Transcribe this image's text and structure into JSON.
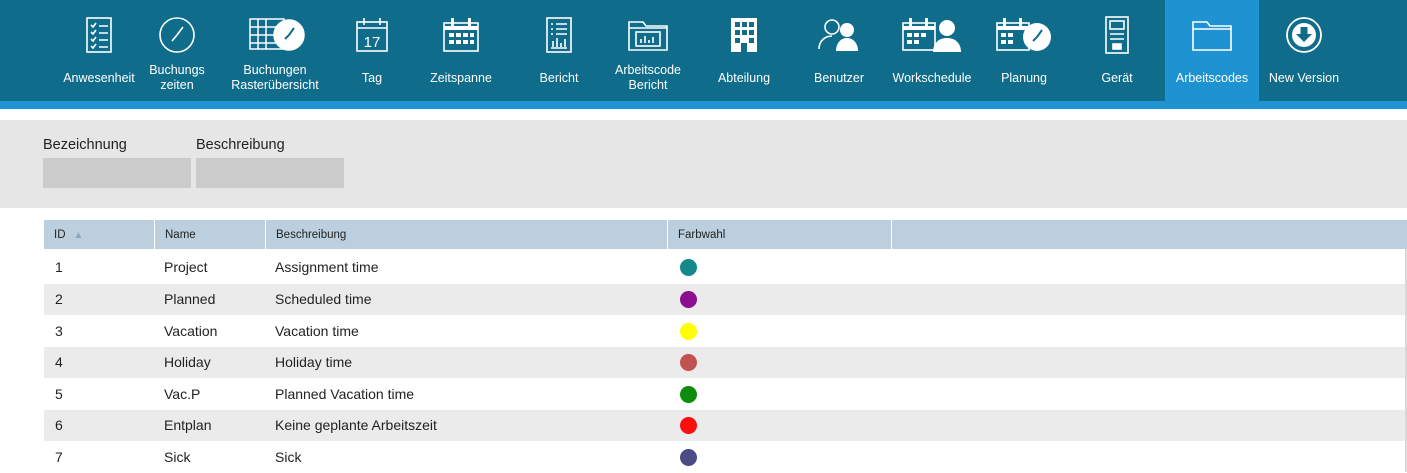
{
  "nav": {
    "items": [
      {
        "label": "Anwesenheit",
        "icon": "attendance-list-icon"
      },
      {
        "label": "Buchungs\nzeiten",
        "icon": "clock-icon"
      },
      {
        "label": "Buchungen\nRasterübersicht",
        "icon": "grid-clock-icon"
      },
      {
        "label": "Tag",
        "icon": "calendar-day-icon",
        "day_number": "17"
      },
      {
        "label": "Zeitspanne",
        "icon": "calendar-range-icon"
      },
      {
        "label": "Bericht",
        "icon": "report-icon"
      },
      {
        "label": "Arbeitscode\nBericht",
        "icon": "folder-chart-icon"
      },
      {
        "label": "Abteilung",
        "icon": "building-icon"
      },
      {
        "label": "Benutzer",
        "icon": "users-icon"
      },
      {
        "label": "Workschedule",
        "icon": "calendar-user-icon"
      },
      {
        "label": "Planung",
        "icon": "calendar-clock-icon"
      },
      {
        "label": "Gerät",
        "icon": "device-icon"
      },
      {
        "label": "Arbeitscodes",
        "icon": "folder-icon",
        "active": true
      },
      {
        "label": "New Version",
        "icon": "download-circle-icon"
      }
    ]
  },
  "filter": {
    "name_label": "Bezeichnung",
    "description_label": "Beschreibung",
    "name_value": "",
    "description_value": ""
  },
  "grid": {
    "columns": [
      "ID",
      "Name",
      "Beschreibung",
      "Farbwahl"
    ],
    "sort_column": "ID",
    "sort_direction": "ascending",
    "rows": [
      {
        "id": "1",
        "name": "Project",
        "description": "Assignment time",
        "color": "#14898c"
      },
      {
        "id": "2",
        "name": "Planned",
        "description": "Scheduled time",
        "color": "#8b0f8e"
      },
      {
        "id": "3",
        "name": "Vacation",
        "description": "Vacation time",
        "color": "#ffff00"
      },
      {
        "id": "4",
        "name": "Holiday",
        "description": "Holiday time",
        "color": "#c25151"
      },
      {
        "id": "5",
        "name": "Vac.P",
        "description": "Planned Vacation time",
        "color": "#0d8c0d"
      },
      {
        "id": "6",
        "name": "Entplan",
        "description": "Keine geplante Arbeitszeit",
        "color": "#fb0f0f"
      },
      {
        "id": "7",
        "name": "Sick",
        "description": "Sick",
        "color": "#4b4b86"
      }
    ]
  },
  "colors": {
    "topbar": "#0f6d8b",
    "accent": "#1f93d1",
    "grid_header": "#bccfde"
  }
}
